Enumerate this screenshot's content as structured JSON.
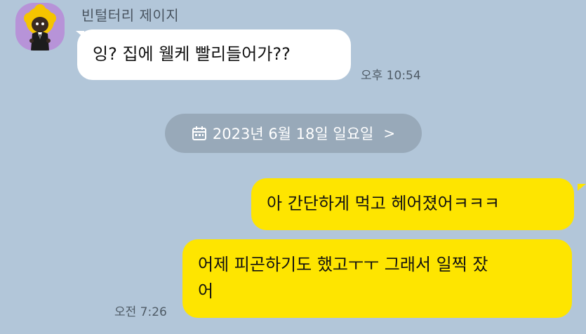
{
  "chat": {
    "sender_name": "빈털터리 제이지",
    "messages": [
      {
        "from": "them",
        "text": "잉? 집에 웰케 빨리들어가??",
        "time": "오후 10:54"
      },
      {
        "from": "me",
        "text": "아 간단하게 먹고 헤어졌어ㅋㅋㅋ"
      },
      {
        "from": "me",
        "text_line1": "어제 피곤하기도 했고ㅜㅜ 그래서 일찍 잤",
        "text_line2": "어",
        "time": "오전 7:26"
      }
    ],
    "date_divider": {
      "label": "2023년 6월 18일 일요일",
      "chevron": ">"
    }
  },
  "colors": {
    "background": "#b2c6d9",
    "incoming_bubble": "#ffffff",
    "outgoing_bubble": "#fee500",
    "avatar_bg": "#b793d8",
    "date_pill": "#98a9b9"
  },
  "icons": {
    "calendar": "calendar-icon",
    "chevron": "chevron-right-icon"
  }
}
